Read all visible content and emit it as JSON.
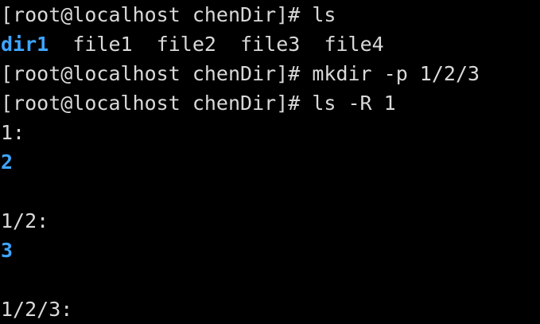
{
  "terminal": {
    "prompt": "[root@localhost chenDir]# ",
    "colors": {
      "background": "#000000",
      "text": "#d9d9d9",
      "directory": "#3ea6ff"
    },
    "commands": {
      "cmd1": "ls",
      "cmd2": "mkdir -p 1/2/3",
      "cmd3": "ls -R 1"
    },
    "ls_output": {
      "dir": "dir1",
      "files": [
        "file1",
        "file2",
        "file3",
        "file4"
      ]
    },
    "recursive_output": {
      "header1": "1:",
      "entry1": "2",
      "header2": "1/2:",
      "entry2": "3",
      "header3": "1/2/3:"
    }
  }
}
